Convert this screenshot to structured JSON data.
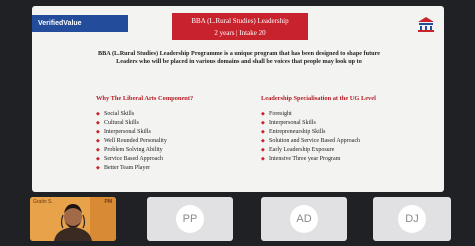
{
  "brand": {
    "label": "VerifiedValue"
  },
  "slide": {
    "title_line1": "BBA (L.Rural Studies) Leadership",
    "title_line2": "2 years | Intake 20",
    "intro": "BBA (L.Rural Studies) Leadership Programme is a unique program that has been designed to shape future Leaders who will be placed in various domains and shall be voices that people may look up to",
    "left_heading": "Why The Liberal Arts Component?",
    "left_items": [
      "Social Skills",
      "Cultural Skills",
      "Interpersonal Skills",
      "Well Rounded Personality",
      "Problem Solving Ability",
      "Service Based Approach",
      "Better Team Player"
    ],
    "right_heading": "Leadership Specialisation at the UG Level",
    "right_items": [
      "Foresight",
      "Interpersonal Skills",
      "Entrepreneurship Skills",
      "Solution and Service Based Approach",
      "Early Leadership Exposure",
      "Intensive Three year Program"
    ]
  },
  "participants": {
    "camera_name": "Gratin S.",
    "camera_tag": "PM",
    "tiles": [
      {
        "initials": "PP"
      },
      {
        "initials": "AD"
      },
      {
        "initials": "DJ"
      }
    ]
  },
  "colors": {
    "accent_red": "#c8232c",
    "brand_blue": "#234c9a",
    "tile_gray": "#e1e1e4"
  }
}
